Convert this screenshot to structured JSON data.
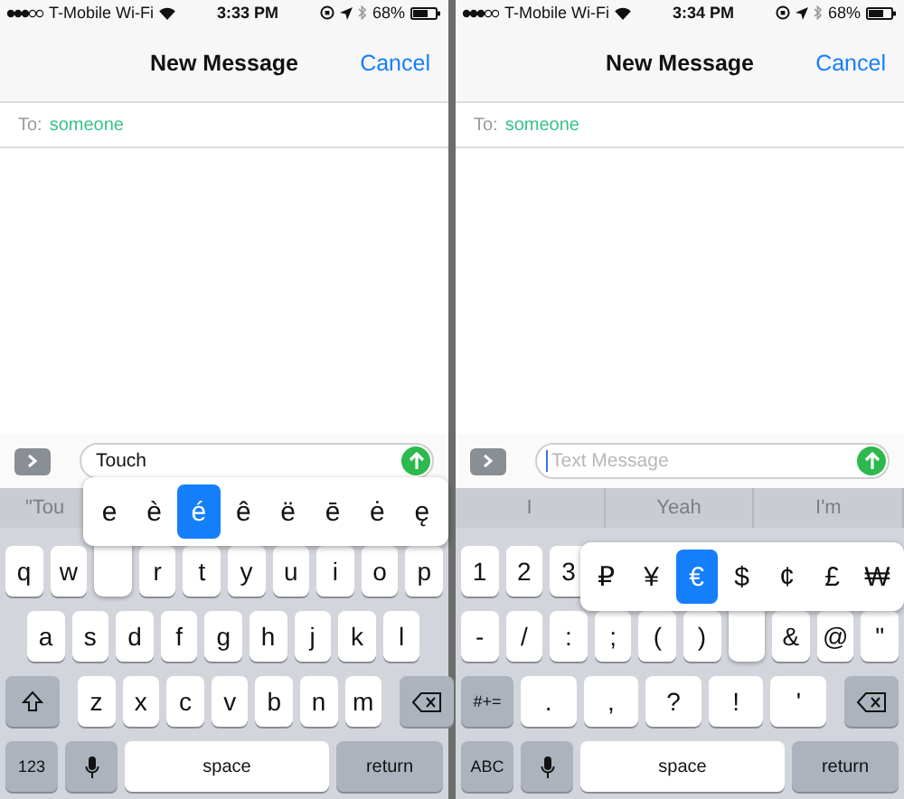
{
  "phones": [
    {
      "status": {
        "carrier": "T-Mobile Wi-Fi",
        "time": "3:33 PM",
        "battery": "68%"
      },
      "title": "New Message",
      "cancel": "Cancel",
      "to_label": "To:",
      "recipient": "someone",
      "message": {
        "value": "Touch"
      },
      "suggestions": [
        "\"Tou"
      ],
      "popup": {
        "variants": [
          {
            "label": "e",
            "selected": false
          },
          {
            "label": "è",
            "selected": false
          },
          {
            "label": "é",
            "selected": true
          },
          {
            "label": "ê",
            "selected": false
          },
          {
            "label": "ë",
            "selected": false
          },
          {
            "label": "ē",
            "selected": false
          },
          {
            "label": "ė",
            "selected": false
          },
          {
            "label": "ę",
            "selected": false
          }
        ]
      },
      "key_rows": [
        {
          "keys": [
            {
              "label": "q",
              "kind": "char"
            },
            {
              "label": "w",
              "kind": "char"
            },
            {
              "kind": "covered"
            },
            {
              "label": "r",
              "kind": "char"
            },
            {
              "label": "t",
              "kind": "char"
            },
            {
              "label": "y",
              "kind": "char"
            },
            {
              "label": "u",
              "kind": "char"
            },
            {
              "label": "i",
              "kind": "char"
            },
            {
              "label": "o",
              "kind": "char"
            },
            {
              "label": "p",
              "kind": "char"
            }
          ]
        },
        {
          "keys": [
            {
              "kind": "indent"
            },
            {
              "label": "a",
              "kind": "char"
            },
            {
              "label": "s",
              "kind": "char"
            },
            {
              "label": "d",
              "kind": "char"
            },
            {
              "label": "f",
              "kind": "char"
            },
            {
              "label": "g",
              "kind": "char"
            },
            {
              "label": "h",
              "kind": "char"
            },
            {
              "label": "j",
              "kind": "char"
            },
            {
              "label": "k",
              "kind": "char"
            },
            {
              "label": "l",
              "kind": "char"
            },
            {
              "kind": "indent"
            }
          ]
        },
        {
          "keys": [
            {
              "kind": "shift"
            },
            {
              "label": "z",
              "kind": "char"
            },
            {
              "label": "x",
              "kind": "char"
            },
            {
              "label": "c",
              "kind": "char"
            },
            {
              "label": "v",
              "kind": "char"
            },
            {
              "label": "b",
              "kind": "char"
            },
            {
              "label": "n",
              "kind": "char"
            },
            {
              "label": "m",
              "kind": "char"
            },
            {
              "kind": "delete"
            }
          ]
        },
        {
          "keys": [
            {
              "label": "123",
              "kind": "mode"
            },
            {
              "kind": "mic"
            },
            {
              "label": "space",
              "kind": "space"
            },
            {
              "label": "return",
              "kind": "return"
            }
          ]
        }
      ]
    },
    {
      "status": {
        "carrier": "T-Mobile Wi-Fi",
        "time": "3:34 PM",
        "battery": "68%"
      },
      "title": "New Message",
      "cancel": "Cancel",
      "to_label": "To:",
      "recipient": "someone",
      "message": {
        "placeholder": "Text Message"
      },
      "suggestions": [
        "I",
        "Yeah",
        "I'm"
      ],
      "popup": {
        "variants": [
          {
            "label": "₽",
            "selected": false
          },
          {
            "label": "¥",
            "selected": false
          },
          {
            "label": "€",
            "selected": true
          },
          {
            "label": "$",
            "selected": false
          },
          {
            "label": "¢",
            "selected": false
          },
          {
            "label": "£",
            "selected": false
          },
          {
            "label": "₩",
            "selected": false
          }
        ]
      },
      "key_rows": [
        {
          "keys": [
            {
              "label": "1",
              "kind": "char"
            },
            {
              "label": "2",
              "kind": "char"
            },
            {
              "label": "3",
              "kind": "char"
            }
          ]
        },
        {
          "keys": [
            {
              "label": "-",
              "kind": "char"
            },
            {
              "label": "/",
              "kind": "char"
            },
            {
              "label": ":",
              "kind": "char"
            },
            {
              "label": ";",
              "kind": "char"
            },
            {
              "label": "(",
              "kind": "char"
            },
            {
              "label": ")",
              "kind": "char"
            },
            {
              "kind": "covered"
            },
            {
              "label": "&",
              "kind": "char"
            },
            {
              "label": "@",
              "kind": "char"
            },
            {
              "label": "\"",
              "kind": "char"
            }
          ]
        },
        {
          "keys": [
            {
              "label": "#+=",
              "kind": "mode"
            },
            {
              "label": ".",
              "kind": "wide"
            },
            {
              "label": ",",
              "kind": "wide"
            },
            {
              "label": "?",
              "kind": "wide"
            },
            {
              "label": "!",
              "kind": "wide"
            },
            {
              "label": "'",
              "kind": "wide"
            },
            {
              "kind": "delete"
            }
          ]
        },
        {
          "keys": [
            {
              "label": "ABC",
              "kind": "mode"
            },
            {
              "kind": "mic"
            },
            {
              "label": "space",
              "kind": "space"
            },
            {
              "label": "return",
              "kind": "return"
            }
          ]
        }
      ]
    }
  ]
}
